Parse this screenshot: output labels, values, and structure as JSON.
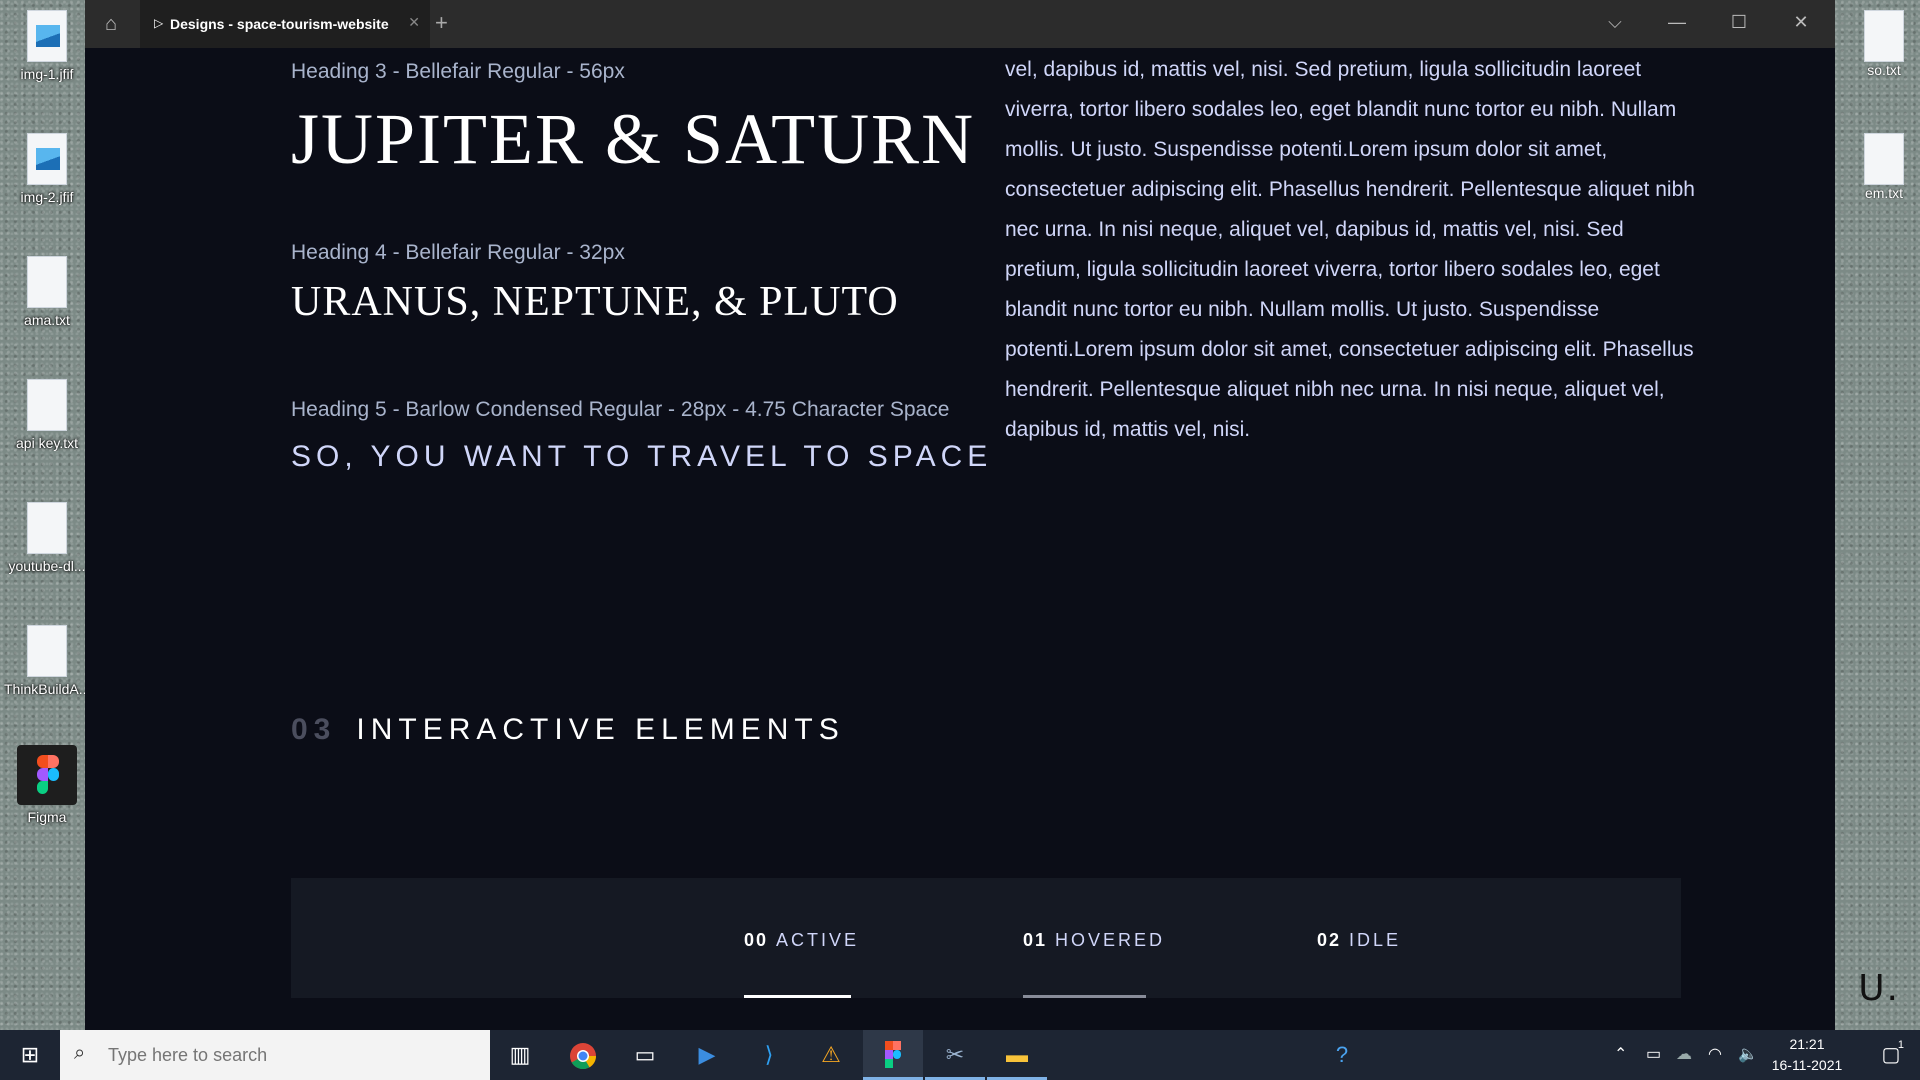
{
  "desktop": {
    "icons": [
      {
        "label": "img-1.jfif"
      },
      {
        "label": "img-2.jfif"
      },
      {
        "label": "ama.txt"
      },
      {
        "label": "api key.txt"
      },
      {
        "label": "youtube-dl..."
      },
      {
        "label": "ThinkBuildA..."
      },
      {
        "label": "Figma"
      }
    ],
    "right_icons": [
      {
        "label": "so.txt"
      },
      {
        "label": "em.txt"
      }
    ],
    "edge_text": "U."
  },
  "window": {
    "tab_title": "Designs - space-tourism-website",
    "new_tab": "+",
    "controls": {
      "dropdown": "⌵",
      "minimize": "—",
      "maximize": "☐",
      "close": "✕"
    }
  },
  "content": {
    "caption_h3": "Heading 3 - Bellefair Regular - 56px",
    "h3": "JUPITER & SATURN",
    "caption_h4": "Heading 4 - Bellefair Regular - 32px",
    "h4": "URANUS, NEPTUNE, & PLUTO",
    "caption_h5": "Heading 5 - Barlow Condensed Regular - 28px - 4.75 Character Space",
    "h5": "SO, YOU WANT TO TRAVEL TO SPACE",
    "body_text": "vel, dapibus id, mattis vel, nisi. Sed pretium, ligula sollicitudin laoreet viverra, tortor libero sodales leo, eget blandit nunc tortor eu nibh. Nullam mollis. Ut justo. Suspendisse potenti.Lorem ipsum dolor sit amet, consectetuer adipiscing elit. Phasellus hendrerit. Pellentesque aliquet nibh nec urna. In nisi neque, aliquet vel, dapibus id, mattis vel, nisi. Sed pretium, ligula sollicitudin laoreet viverra, tortor libero sodales leo, eget blandit nunc tortor eu nibh. Nullam mollis. Ut justo. Suspendisse potenti.Lorem ipsum dolor sit amet, consectetuer adipiscing elit. Phasellus hendrerit. Pellentesque aliquet nibh nec urna. In nisi neque, aliquet vel, dapibus id, mattis vel, nisi.",
    "section": {
      "number": "03",
      "title": "INTERACTIVE ELEMENTS"
    },
    "nav_states": [
      {
        "num": "00",
        "label": "ACTIVE",
        "bar_color": "#ffffff"
      },
      {
        "num": "01",
        "label": "HOVERED",
        "bar_color": "#888c99"
      },
      {
        "num": "02",
        "label": "IDLE",
        "bar_color": "transparent"
      }
    ]
  },
  "taskbar": {
    "search_placeholder": "Type here to search",
    "time": "21:21",
    "date": "16-11-2021",
    "notification_count": "1"
  },
  "colors": {
    "background": "#0b0d17",
    "text_light": "#d0d6f9",
    "white": "#ffffff",
    "panel": "#151923"
  }
}
